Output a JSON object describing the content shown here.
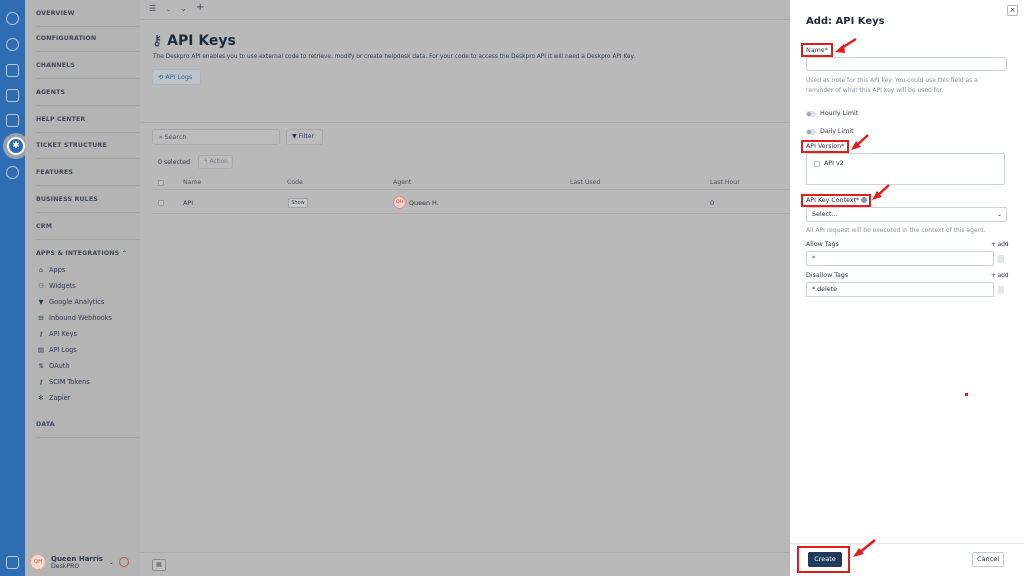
{
  "sidebar": {
    "sections": [
      "OVERVIEW",
      "CONFIGURATION",
      "CHANNELS",
      "AGENTS",
      "HELP CENTER",
      "TICKET STRUCTURE",
      "FEATURES",
      "BUSINESS RULES",
      "CRM"
    ],
    "apps_section": "APPS & INTEGRATIONS",
    "apps_items": [
      {
        "label": "Apps",
        "icon": "home-icon",
        "glyph": "⌂"
      },
      {
        "label": "Widgets",
        "icon": "widget-icon",
        "glyph": "⚇"
      },
      {
        "label": "Google Analytics",
        "icon": "chart-icon",
        "glyph": "▼"
      },
      {
        "label": "Inbound Webhooks",
        "icon": "webhook-icon",
        "glyph": "⊟"
      },
      {
        "label": "API Keys",
        "icon": "key-icon",
        "glyph": "⚷"
      },
      {
        "label": "API Logs",
        "icon": "log-icon",
        "glyph": "▤"
      },
      {
        "label": "OAuth",
        "icon": "oauth-icon",
        "glyph": "⇅"
      },
      {
        "label": "SCIM Tokens",
        "icon": "token-icon",
        "glyph": "⚷"
      },
      {
        "label": "Zapier",
        "icon": "zapier-icon",
        "glyph": "✻"
      }
    ],
    "data_section": "DATA",
    "user": {
      "initials": "QH",
      "name": "Queen Harris",
      "org": "DeskPRO"
    }
  },
  "page": {
    "title": "API Keys",
    "description": "The Deskpro API enables you to use external code to retrieve, modify or create helpdesk data. For your code to access the Deskpro API it will need a Deskpro API Key.",
    "logs_button": "API Logs",
    "search_placeholder": "Search",
    "filter_label": "Filter",
    "selected_text": "0 selected",
    "action_label": "Action",
    "columns": [
      "Name",
      "Code",
      "Agent",
      "Last Used",
      "Last Hour"
    ],
    "rows": [
      {
        "name": "API",
        "code": "Show",
        "agent_initials": "QH",
        "agent": "Queen H.",
        "last_used": "",
        "last_hour": "0"
      }
    ]
  },
  "drawer": {
    "title": "Add: API Keys",
    "name_label": "Name*",
    "name_help": "Used as note for this API key. You could use this field as a reminder of what this API key will be used for.",
    "hourly_limit": "Hourly Limit",
    "daily_limit": "Daily Limit",
    "version_label": "API Version*",
    "version_option": "API v2",
    "context_label": "API Key Context*",
    "context_value": "Select...",
    "context_help": "All API request will be executed in the context of this agent.",
    "allow_tags_label": "Allow Tags",
    "allow_tags_value": "*",
    "disallow_tags_label": "Disallow Tags",
    "disallow_tags_value": "*.delete",
    "add_label": "+ add",
    "create_label": "Create",
    "cancel_label": "Cancel",
    "close_glyph": "×"
  },
  "colors": {
    "brand": "#2e6db4",
    "highlight": "#e11d1d",
    "create": "#1e3a5c"
  }
}
